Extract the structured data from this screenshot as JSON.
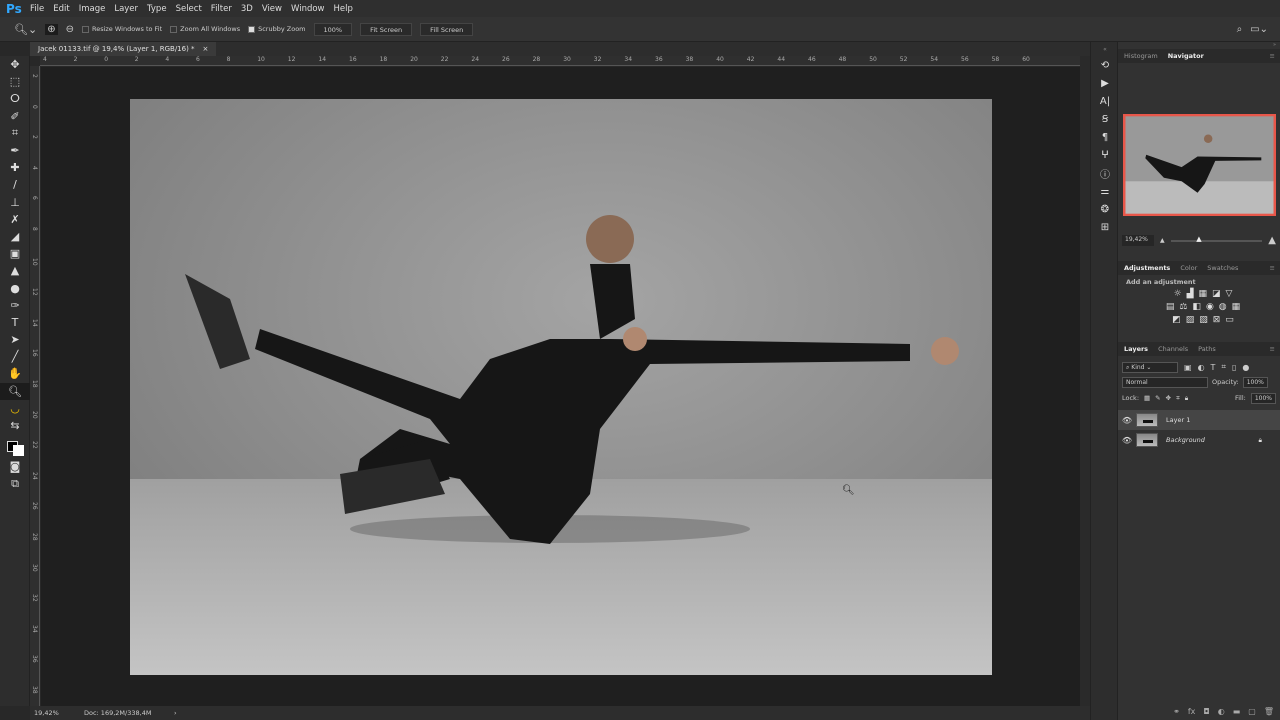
{
  "app": {
    "logo": "Ps"
  },
  "menu": [
    "File",
    "Edit",
    "Image",
    "Layer",
    "Type",
    "Select",
    "Filter",
    "3D",
    "View",
    "Window",
    "Help"
  ],
  "options": {
    "resize_windows": "Resize Windows to Fit",
    "resize_checked": false,
    "zoom_all": "Zoom All Windows",
    "zoom_all_checked": false,
    "scrubby": "Scrubby Zoom",
    "scrubby_checked": true,
    "zoom_value": "100%",
    "fit_screen": "Fit Screen",
    "fill_screen": "Fill Screen"
  },
  "document": {
    "tab_title": "Jacek 01133.tif @ 19,4% (Layer 1, RGB/16) *",
    "close": "×"
  },
  "ruler": {
    "h_labels": [
      "4",
      "2",
      "0",
      "2",
      "4",
      "6",
      "8",
      "10",
      "12",
      "14",
      "16",
      "18",
      "20",
      "22",
      "24",
      "26",
      "28",
      "30",
      "32",
      "34",
      "36",
      "38",
      "40",
      "42",
      "44",
      "46",
      "48",
      "50",
      "52",
      "54",
      "56",
      "58",
      "60"
    ],
    "v_labels": [
      "2",
      "0",
      "2",
      "4",
      "6",
      "8",
      "10",
      "12",
      "14",
      "16",
      "18",
      "20",
      "22",
      "24",
      "26",
      "28",
      "30",
      "32",
      "34",
      "36",
      "38"
    ]
  },
  "status": {
    "zoom": "19,42%",
    "doc": "Doc: 169,2M/338,4M",
    "arrow": "›"
  },
  "tools": [
    "move",
    "marquee",
    "lasso",
    "quick-select",
    "crop",
    "eyedropper",
    "healing",
    "brush",
    "stamp",
    "history-brush",
    "eraser",
    "gradient",
    "blur",
    "dodge",
    "pen",
    "type",
    "path-select",
    "line",
    "hand",
    "zoom",
    "banana",
    "swap-colors",
    "colors",
    "quick-mask",
    "screen-mode"
  ],
  "navigator": {
    "tabs": [
      "Histogram",
      "Navigator"
    ],
    "active": "Navigator",
    "zoom": "19,42%",
    "slider_fraction": 0.28,
    "view_box_color": "#e8574a"
  },
  "adjustments": {
    "tabs": [
      "Adjustments",
      "Color",
      "Swatches"
    ],
    "active": "Adjustments",
    "hint": "Add an adjustment"
  },
  "layers": {
    "tabs": [
      "Layers",
      "Channels",
      "Paths"
    ],
    "active": "Layers",
    "filter": "Kind",
    "blend": "Normal",
    "opacity_label": "Opacity:",
    "opacity": "100%",
    "lock_label": "Lock:",
    "fill_label": "Fill:",
    "fill": "100%",
    "items": [
      {
        "name": "Layer 1",
        "selected": true,
        "locked": false
      },
      {
        "name": "Background",
        "selected": false,
        "locked": true
      }
    ]
  },
  "colors": {
    "accent": "#31a8ff",
    "background": "#282828",
    "canvas": "#1f1f1f"
  }
}
